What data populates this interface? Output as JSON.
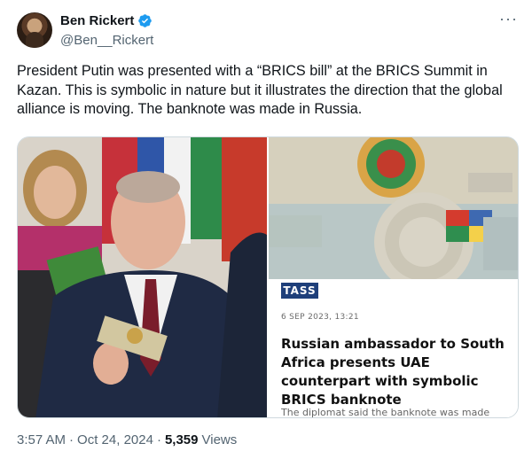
{
  "author": {
    "display_name": "Ben Rickert",
    "handle": "@Ben__Rickert",
    "verified_icon": "verified-badge-icon",
    "verified_color": "#1d9bf0"
  },
  "more_label": "···",
  "tweet": {
    "text": "President Putin was presented with a “BRICS bill” at the BRICS Summit in Kazan. This is symbolic in nature but it illustrates the direction that the global alliance is moving. The banknote was made in Russia."
  },
  "media": {
    "tass_card": {
      "logo": "TASS",
      "date": "6 SEP 2023, 13:21",
      "headline": "Russian ambassador to South Africa presents UAE counterpart with symbolic BRICS banknote",
      "subtext": "The diplomat said the banknote was made"
    }
  },
  "footer": {
    "time": "3:57 AM",
    "separator": "·",
    "date": "Oct 24, 2024",
    "views_count": "5,359",
    "views_label": "Views"
  }
}
